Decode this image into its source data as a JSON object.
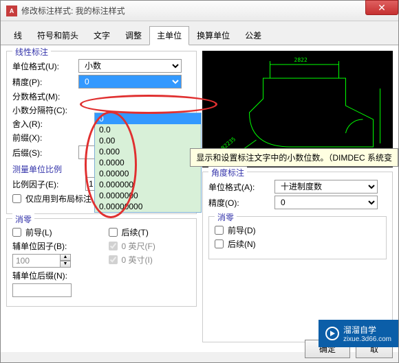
{
  "window": {
    "title": "修改标注样式: 我的标注样式",
    "app_icon": "A"
  },
  "close": {
    "glyph": "✕"
  },
  "tabs": [
    "线",
    "符号和箭头",
    "文字",
    "调整",
    "主单位",
    "换算单位",
    "公差"
  ],
  "active_tab": 4,
  "linear": {
    "legend": "线性标注",
    "unit_format_label": "单位格式(U):",
    "unit_format_value": "小数",
    "precision_label": "精度(P):",
    "precision_value": "0",
    "precision_options": [
      "0",
      "0.0",
      "0.00",
      "0.000",
      "0.0000",
      "0.00000",
      "0.000000",
      "0.0000000",
      "0.00000000"
    ],
    "fraction_format_label": "分数格式(M):",
    "decimal_sep_label": "小数分隔符(C):",
    "round_label": "舍入(R):",
    "prefix_label": "前缀(X):",
    "suffix_label": "后缀(S):"
  },
  "scale": {
    "legend": "测量单位比例",
    "factor_label": "比例因子(E):",
    "factor_value": "1",
    "layout_only_label": "仅应用到布局标注"
  },
  "zero_sup": {
    "legend": "消零",
    "leading_label": "前导(L)",
    "trailing_label": "后续(T)",
    "aux_factor_label": "辅单位因子(B):",
    "aux_factor_value": "100",
    "aux_suffix_label": "辅单位后缀(N):",
    "zero_feet_label": "0 英尺(F)",
    "zero_inches_label": "0 英寸(I)"
  },
  "angle": {
    "legend": "角度标注",
    "unit_format_label": "单位格式(A):",
    "unit_format_value": "十进制度数",
    "precision_label": "精度(O):",
    "precision_value": "0",
    "zero_legend": "消零",
    "leading_label": "前导(D)",
    "trailing_label": "后续(N)"
  },
  "preview": {
    "dim_label": "2822",
    "r_label": "R2235"
  },
  "tooltip": "显示和设置标注文字中的小数位数。（DIMDEC 系统变",
  "buttons": {
    "ok": "确定",
    "cancel": "取"
  },
  "watermark": {
    "brand": "溜溜自学",
    "url": "zixue.3d66.com"
  }
}
